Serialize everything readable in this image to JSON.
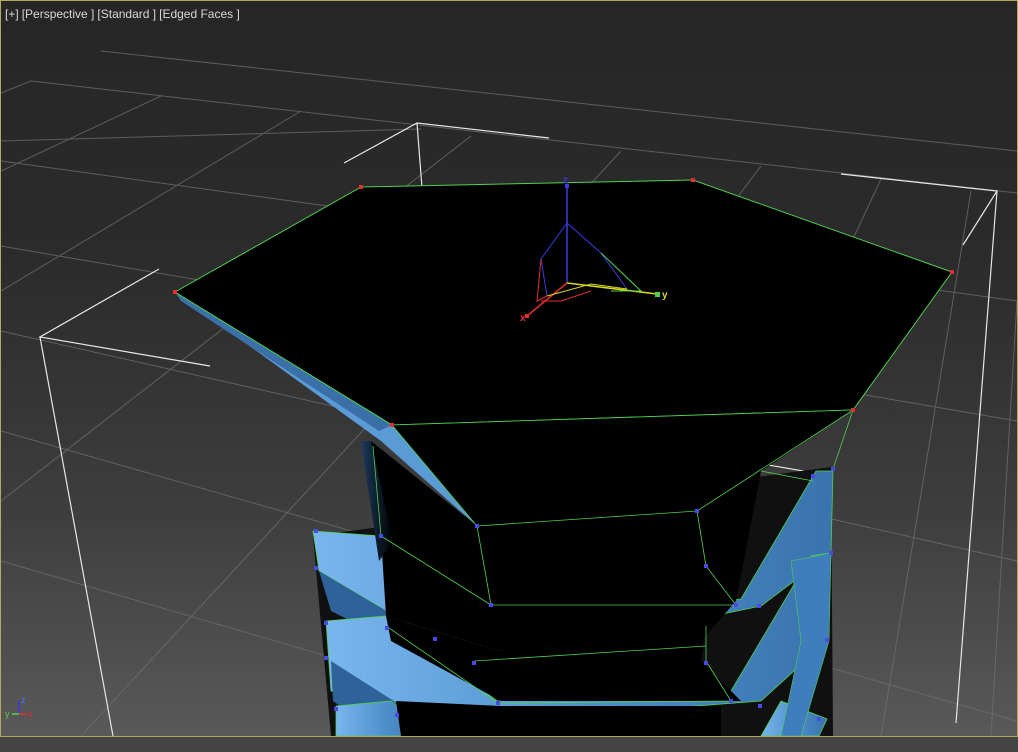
{
  "viewport": {
    "labels": [
      {
        "name": "viewport-menu-plus",
        "text": "[+]"
      },
      {
        "name": "viewport-point-of-view-menu",
        "text": "[Perspective ]"
      },
      {
        "name": "viewport-shading-style-menu",
        "text": "[Standard ]"
      },
      {
        "name": "viewport-display-mode-menu",
        "text": "[Edged Faces ]"
      }
    ],
    "gizmo": {
      "x_label": "x",
      "y_label": "y",
      "z_label": "z"
    },
    "tripod": {
      "x_label": "x",
      "y_label": "y",
      "z_label": "z"
    }
  },
  "colors": {
    "frame": "#b9a75a",
    "grid": "#777777",
    "bounding_box": "#e6e6e6",
    "face_black": "#000000",
    "face_blue": "#5b9bd5",
    "edge_green": "#4fd04f",
    "vertex_red": "#e23030",
    "vertex_blue": "#4a4ae8",
    "axis_x": "#e03030",
    "axis_y": "#d8d820",
    "axis_z": "#3a3ae0"
  }
}
